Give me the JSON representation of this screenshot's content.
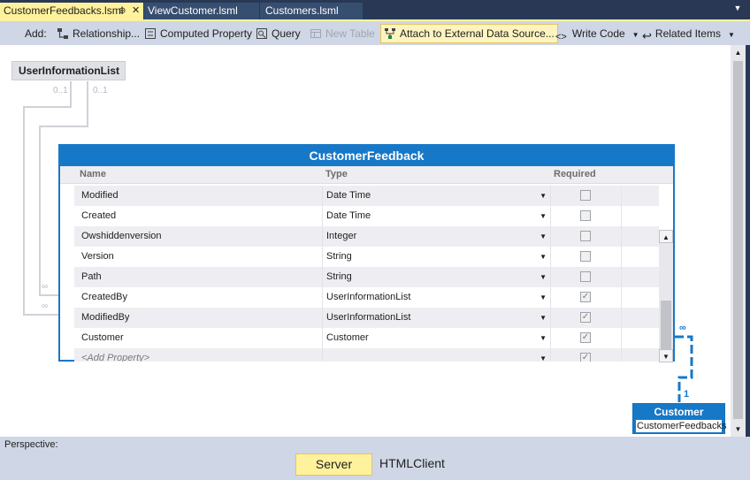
{
  "tabs": [
    {
      "label": "CustomerFeedbacks.lsml",
      "active": true,
      "pin": "⊕",
      "close": "✕"
    },
    {
      "label": "ViewCustomer.lsml",
      "active": false
    },
    {
      "label": "Customers.lsml",
      "active": false
    }
  ],
  "tab_dropdown": "▼",
  "toolbar": {
    "add_label": "Add:",
    "relationship": "Relationship...",
    "computed_property": "Computed Property",
    "query": "Query",
    "new_table": "New Table",
    "attach": "Attach to External Data Source...",
    "write_code": "Write Code",
    "related_items": "Related Items"
  },
  "canvas": {
    "user_info_list": "UserInformationList",
    "card_labels": [
      "0..1",
      "0..1",
      "∞",
      "∞"
    ]
  },
  "entity": {
    "title": "CustomerFeedback",
    "columns": {
      "name": "Name",
      "type": "Type",
      "required": "Required"
    },
    "rows": [
      {
        "name": "Modified",
        "type": "Date Time",
        "required": false
      },
      {
        "name": "Created",
        "type": "Date Time",
        "required": false
      },
      {
        "name": "Owshiddenversion",
        "type": "Integer",
        "required": false
      },
      {
        "name": "Version",
        "type": "String",
        "required": false
      },
      {
        "name": "Path",
        "type": "String",
        "required": false
      },
      {
        "name": "CreatedBy",
        "type": "UserInformationList",
        "required": true
      },
      {
        "name": "ModifiedBy",
        "type": "UserInformationList",
        "required": true
      },
      {
        "name": "Customer",
        "type": "Customer",
        "required": true
      }
    ],
    "add_property": "<Add Property>"
  },
  "customer_node": {
    "title": "Customer",
    "subtitle": "CustomerFeedbacks",
    "rel_many": "∞",
    "rel_one": "1"
  },
  "perspective": {
    "label": "Perspective:",
    "server": "Server",
    "html_client": "HTMLClient"
  },
  "colors": {
    "accent_blue": "#1778c8",
    "active_yellow": "#fff29d",
    "frame_dark": "#293955",
    "toolbar_bg": "#cfd6e5"
  }
}
